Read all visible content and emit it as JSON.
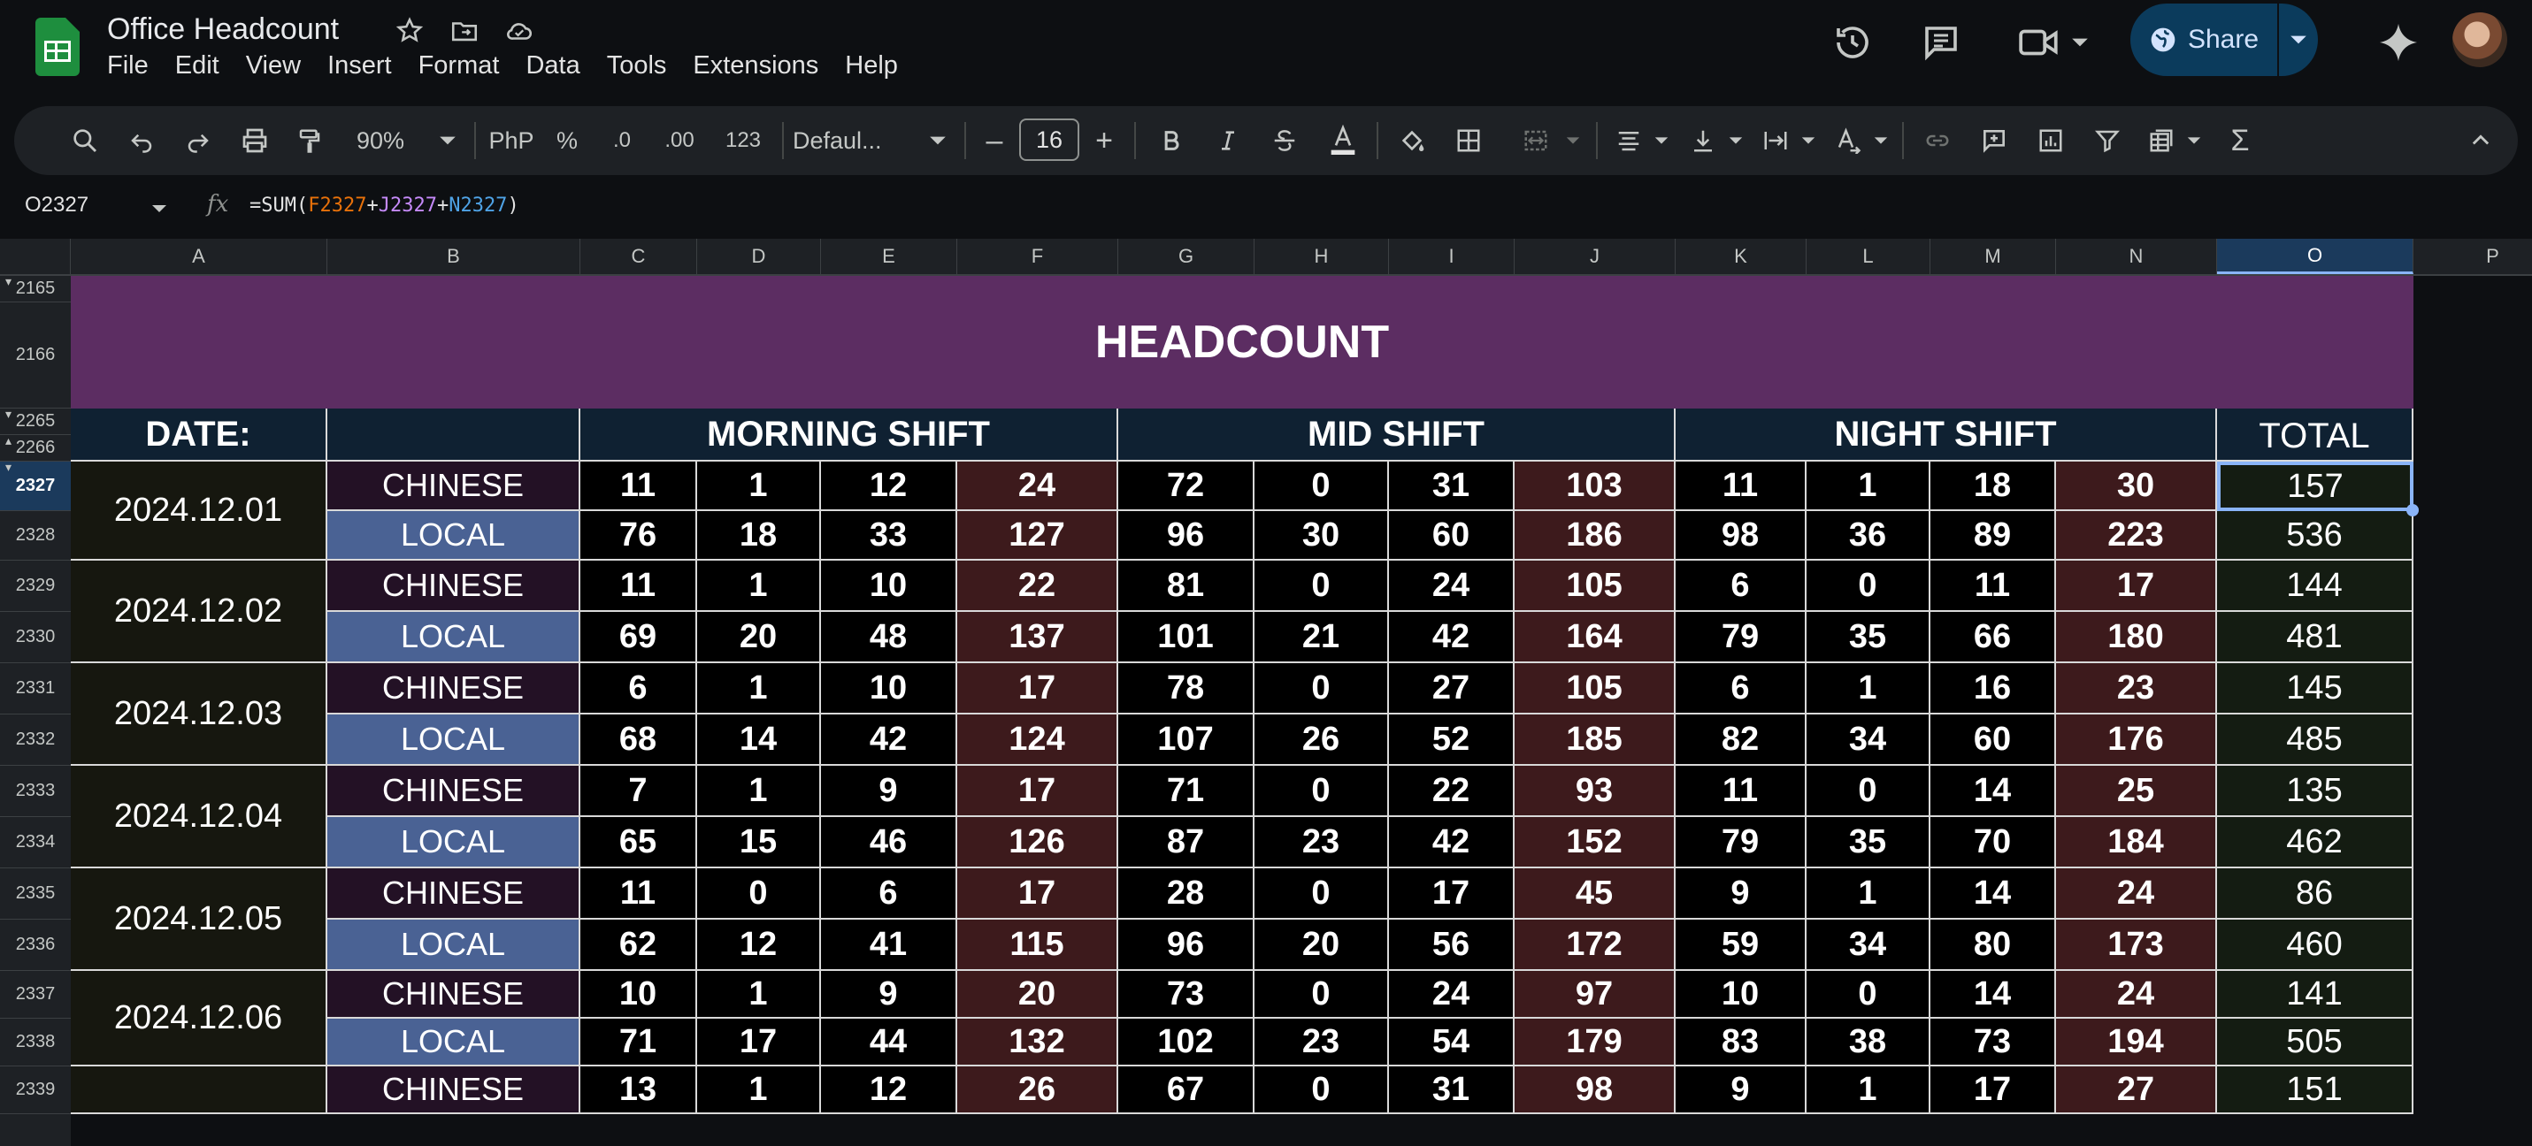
{
  "app": {
    "title": "Office Headcount",
    "menu": [
      "File",
      "Edit",
      "View",
      "Insert",
      "Format",
      "Data",
      "Tools",
      "Extensions",
      "Help"
    ],
    "share_label": "Share"
  },
  "toolbar": {
    "zoom": "90%",
    "currency": "PhP",
    "percent": "%",
    "decimal_decrease": ".0",
    "decimal_increase": ".00",
    "format_more": "123",
    "font": "Defaul...",
    "font_size": "16",
    "minus": "–",
    "plus": "+",
    "sum_symbol": "Σ"
  },
  "formula_bar": {
    "cell_ref": "O2327",
    "fx": "fx",
    "formula_parts": [
      "=SUM(",
      "F2327",
      "+",
      "J2327",
      "+",
      "N2327",
      ")"
    ]
  },
  "columns": [
    "A",
    "B",
    "C",
    "D",
    "E",
    "F",
    "G",
    "H",
    "I",
    "J",
    "K",
    "L",
    "M",
    "N",
    "O",
    "P"
  ],
  "selected_column": "O",
  "rows": [
    "2165",
    "2166",
    "2265",
    "2266",
    "2327",
    "2328",
    "2329",
    "2330",
    "2331",
    "2332",
    "2333",
    "2334",
    "2335",
    "2336",
    "2337",
    "2338",
    "2339"
  ],
  "selected_row": "2327",
  "sheet": {
    "title": "HEADCOUNT",
    "date_label": "DATE:",
    "morning": "MORNING SHIFT",
    "mid": "MID SHIFT",
    "night": "NIGHT SHIFT",
    "total": "TOTAL",
    "records": [
      {
        "date": "2024.12.01",
        "chinese": [
          "11",
          "1",
          "12",
          "24",
          "72",
          "0",
          "31",
          "103",
          "11",
          "1",
          "18",
          "30",
          "157"
        ],
        "local": [
          "76",
          "18",
          "33",
          "127",
          "96",
          "30",
          "60",
          "186",
          "98",
          "36",
          "89",
          "223",
          "536"
        ]
      },
      {
        "date": "2024.12.02",
        "chinese": [
          "11",
          "1",
          "10",
          "22",
          "81",
          "0",
          "24",
          "105",
          "6",
          "0",
          "11",
          "17",
          "144"
        ],
        "local": [
          "69",
          "20",
          "48",
          "137",
          "101",
          "21",
          "42",
          "164",
          "79",
          "35",
          "66",
          "180",
          "481"
        ]
      },
      {
        "date": "2024.12.03",
        "chinese": [
          "6",
          "1",
          "10",
          "17",
          "78",
          "0",
          "27",
          "105",
          "6",
          "1",
          "16",
          "23",
          "145"
        ],
        "local": [
          "68",
          "14",
          "42",
          "124",
          "107",
          "26",
          "52",
          "185",
          "82",
          "34",
          "60",
          "176",
          "485"
        ]
      },
      {
        "date": "2024.12.04",
        "chinese": [
          "7",
          "1",
          "9",
          "17",
          "71",
          "0",
          "22",
          "93",
          "11",
          "0",
          "14",
          "25",
          "135"
        ],
        "local": [
          "65",
          "15",
          "46",
          "126",
          "87",
          "23",
          "42",
          "152",
          "79",
          "35",
          "70",
          "184",
          "462"
        ]
      },
      {
        "date": "2024.12.05",
        "chinese": [
          "11",
          "0",
          "6",
          "17",
          "28",
          "0",
          "17",
          "45",
          "9",
          "1",
          "14",
          "24",
          "86"
        ],
        "local": [
          "62",
          "12",
          "41",
          "115",
          "96",
          "20",
          "56",
          "172",
          "59",
          "34",
          "80",
          "173",
          "460"
        ]
      },
      {
        "date": "2024.12.06",
        "chinese": [
          "10",
          "1",
          "9",
          "20",
          "73",
          "0",
          "24",
          "97",
          "10",
          "0",
          "14",
          "24",
          "141"
        ],
        "local": [
          "71",
          "17",
          "44",
          "132",
          "102",
          "23",
          "54",
          "179",
          "83",
          "38",
          "73",
          "194",
          "505"
        ]
      },
      {
        "date": "",
        "chinese": [
          "13",
          "1",
          "12",
          "26",
          "67",
          "0",
          "31",
          "98",
          "9",
          "1",
          "17",
          "27",
          "151"
        ],
        "local": null
      }
    ],
    "chinese_label": "CHINESE",
    "local_label": "LOCAL"
  }
}
